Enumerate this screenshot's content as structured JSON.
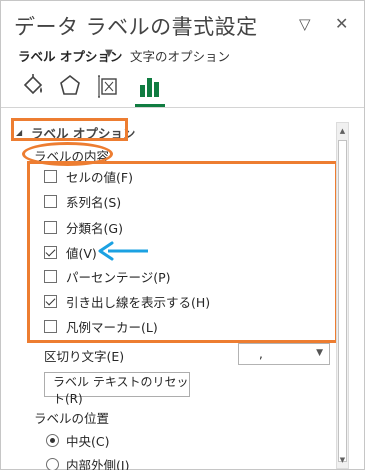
{
  "header": {
    "title": "データ ラベルの書式設定",
    "pin_icon": "▽",
    "close_icon": "✕"
  },
  "subnav": {
    "label_options": "ラベル オプション",
    "caret": "▼",
    "text_options": "文字のオプション"
  },
  "tabs": [
    "fill-line-icon",
    "effects-icon",
    "size-properties-icon",
    "label-options-icon"
  ],
  "section": {
    "title": "ラベル オプション",
    "contents_title": "ラベルの内容"
  },
  "checkboxes": [
    {
      "label": "セルの値(F)",
      "checked": false
    },
    {
      "label": "系列名(S)",
      "checked": false
    },
    {
      "label": "分類名(G)",
      "checked": false
    },
    {
      "label": "値(V)",
      "checked": true
    },
    {
      "label": "パーセンテージ(P)",
      "checked": false
    },
    {
      "label": "引き出し線を表示する(H)",
      "checked": true
    },
    {
      "label": "凡例マーカー(L)",
      "checked": false
    }
  ],
  "separator": {
    "label": "区切り文字(E)",
    "value": ","
  },
  "reset_button": "ラベル テキストのリセット(R)",
  "position": {
    "title": "ラベルの位置",
    "options": [
      {
        "label": "中央(C)",
        "selected": true
      },
      {
        "label": "内部外側(I)",
        "selected": false
      }
    ]
  },
  "colors": {
    "highlight": "#ed7d31",
    "arrow": "#1ba1e2",
    "accent_green": "#107c41"
  }
}
